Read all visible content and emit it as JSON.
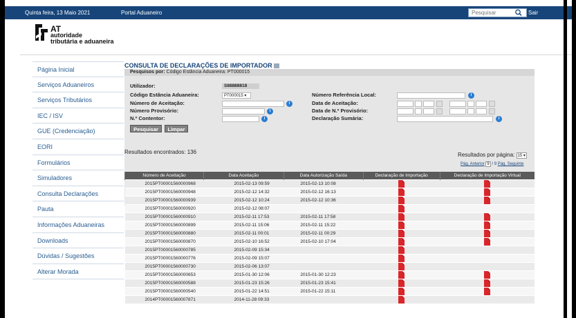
{
  "topbar": {
    "date": "Quinta feira, 13 Maio 2021",
    "portal": "Portal Aduaneiro",
    "search_placeholder": "Pesquisar",
    "logout": "Sair"
  },
  "logo": {
    "acronym": "AT",
    "line1": "autoridade",
    "line2": "tributária e aduaneira"
  },
  "sidebar": {
    "items": [
      {
        "label": "Página Inicial"
      },
      {
        "label": "Serviços Aduaneiros"
      },
      {
        "label": "Serviços Tributários"
      },
      {
        "label": "IEC / ISV"
      },
      {
        "label": "GUE (Credenciação)"
      },
      {
        "label": "EORI"
      },
      {
        "label": "Formulários"
      },
      {
        "label": "Simuladores"
      },
      {
        "label": "Consulta Declarações"
      },
      {
        "label": "Pauta"
      },
      {
        "label": "Informações Aduaneiras"
      },
      {
        "label": "Downloads"
      },
      {
        "label": "Dúvidas / Sugestões"
      },
      {
        "label": "Alterar Morada"
      }
    ]
  },
  "main": {
    "title": "CONSULTA DE DECLARAÇÕES DE IMPORTADOR",
    "search_by_label": "Pesquisos por:",
    "search_by_value": "Código Estância Aduaneira: PT000015",
    "form": {
      "utilizador_label": "Utilizador:",
      "utilizador_value": "S88888818",
      "codigo_label": "Código Estância Aduaneira:",
      "codigo_value": "PT000015 ▾",
      "num_aceitacao_label": "Número de Aceitação:",
      "num_provisorio_label": "Número Provisório:",
      "contentor_label": "N.º Contentor:",
      "ref_local_label": "Número Referência Local:",
      "data_aceitacao_label": "Data de Aceitação:",
      "data_provisorio_label": "Data de N.º Provisório:",
      "decl_sumaria_label": "Declaração Sumária:",
      "search_button": "Pesquisar",
      "clear_button": "Limpar"
    },
    "results_found": "Resultados encontrados: 136",
    "per_page_label": "Resultados por página:",
    "per_page_value": "15 ▾",
    "prev_label": "Pág. Anterior",
    "page_value": "9",
    "page_total": "/ 9",
    "next_label": "Pág. Seguinte",
    "table": {
      "headers": [
        "Número de Aceitação",
        "Data Aceitação",
        "Data Autorização Saída",
        "Declaração de Importação",
        "Declaração de Importação Virtual"
      ],
      "rows": [
        {
          "num": "2015PT00001560000968",
          "data": "2015-02-13 09:59",
          "saida": "2015-02-13 10:08",
          "pdf": true,
          "vpdf": true
        },
        {
          "num": "2015PT00001560000948",
          "data": "2015-02-12 14:32",
          "saida": "2015-02-12 16:13",
          "pdf": true,
          "vpdf": true
        },
        {
          "num": "2015PT00001560000939",
          "data": "2015-02-12 10:24",
          "saida": "2015-02-12 10:36",
          "pdf": true,
          "vpdf": true
        },
        {
          "num": "2015PT00001560000920",
          "data": "2015-02-12 08:07",
          "saida": "",
          "pdf": true,
          "vpdf": false
        },
        {
          "num": "2015PT00001560000910",
          "data": "2015-02-11 17:53",
          "saida": "2015-02-11 17:58",
          "pdf": true,
          "vpdf": true
        },
        {
          "num": "2015PT00001560000899",
          "data": "2015-02-11 15:06",
          "saida": "2015-02-11 15:22",
          "pdf": true,
          "vpdf": true
        },
        {
          "num": "2015PT00001560000880",
          "data": "2015-02-11 00:01",
          "saida": "2015-02-11 00:29",
          "pdf": true,
          "vpdf": true
        },
        {
          "num": "2015PT00001560000870",
          "data": "2015-02-10 16:52",
          "saida": "2015-02-10 17:04",
          "pdf": true,
          "vpdf": true
        },
        {
          "num": "2015PT00001560000785",
          "data": "2015-02-09 15:34",
          "saida": "",
          "pdf": true,
          "vpdf": false
        },
        {
          "num": "2015PT00001560000776",
          "data": "2015-02-09 15:07",
          "saida": "",
          "pdf": true,
          "vpdf": false
        },
        {
          "num": "2015PT00001560000730",
          "data": "2015-02-06 13:07",
          "saida": "",
          "pdf": true,
          "vpdf": false
        },
        {
          "num": "2015PT00001560000653",
          "data": "2015-01-30 12:06",
          "saida": "2015-01-30 12:23",
          "pdf": true,
          "vpdf": true
        },
        {
          "num": "2015PT00001560000588",
          "data": "2015-01-23 15:26",
          "saida": "2015-01-23 15:41",
          "pdf": true,
          "vpdf": true
        },
        {
          "num": "2015PT00001560000540",
          "data": "2015-01-22 14:51",
          "saida": "2015-01-22 15:11",
          "pdf": true,
          "vpdf": true
        },
        {
          "num": "2014PT00001560007871",
          "data": "2014-11-28 09:33",
          "saida": "",
          "pdf": true,
          "vpdf": false
        }
      ]
    }
  },
  "colors": {
    "topbar": "#17457a",
    "link": "#2a5e92",
    "pdf": "#d9262b",
    "info": "#2a7dd2"
  }
}
